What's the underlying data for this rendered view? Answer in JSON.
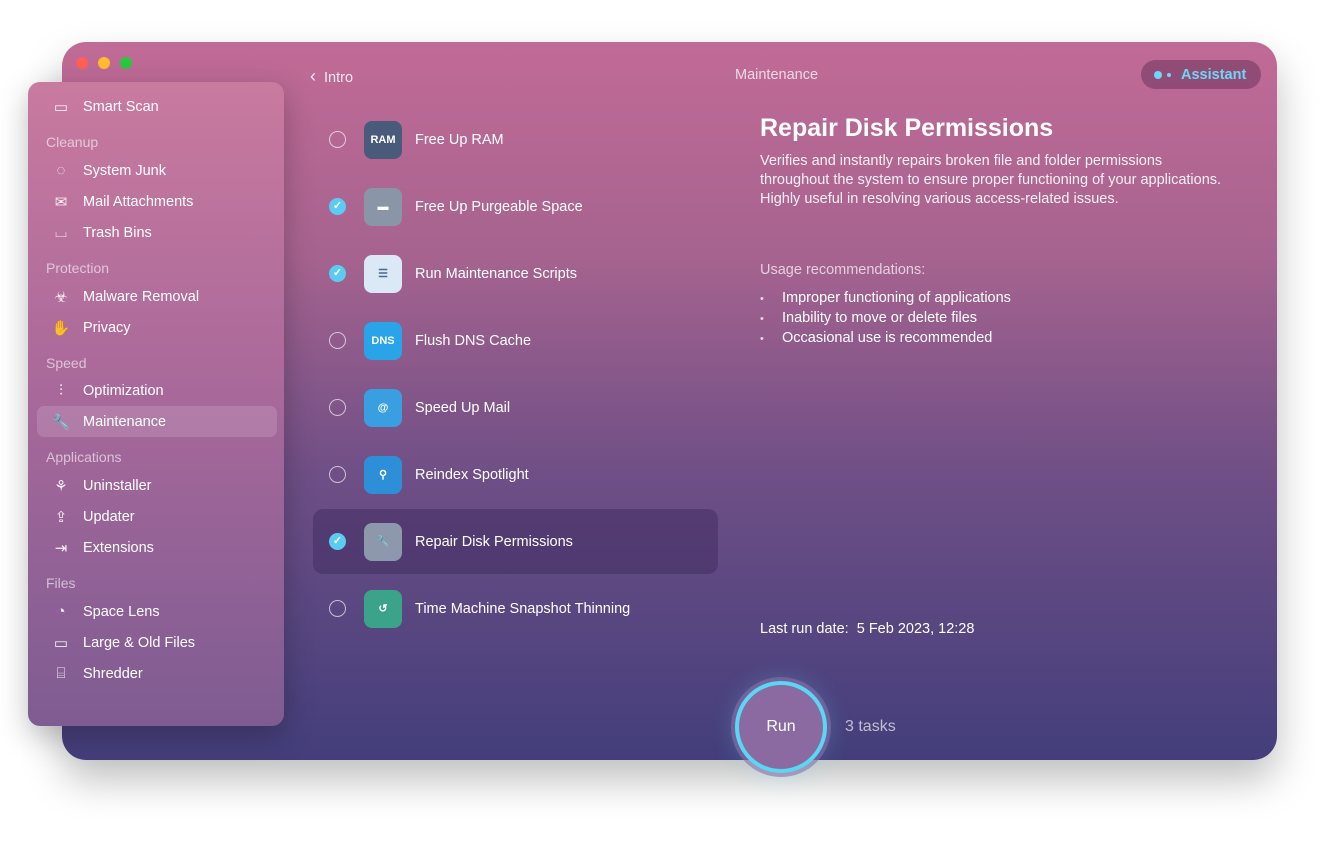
{
  "window": {
    "title": "Maintenance",
    "back_label": "Intro",
    "assistant_label": "Assistant"
  },
  "sidebar": {
    "smart_scan": "Smart Scan",
    "sections": [
      {
        "heading": "Cleanup",
        "items": [
          "System Junk",
          "Mail Attachments",
          "Trash Bins"
        ]
      },
      {
        "heading": "Protection",
        "items": [
          "Malware Removal",
          "Privacy"
        ]
      },
      {
        "heading": "Speed",
        "items": [
          "Optimization",
          "Maintenance"
        ]
      },
      {
        "heading": "Applications",
        "items": [
          "Uninstaller",
          "Updater",
          "Extensions"
        ]
      },
      {
        "heading": "Files",
        "items": [
          "Space Lens",
          "Large & Old Files",
          "Shredder"
        ]
      }
    ],
    "active": "Maintenance"
  },
  "tasks": [
    {
      "label": "Free Up RAM",
      "checked": false,
      "icon": "ram-icon",
      "icon_text": "RAM"
    },
    {
      "label": "Free Up Purgeable Space",
      "checked": true,
      "icon": "disk-icon"
    },
    {
      "label": "Run Maintenance Scripts",
      "checked": true,
      "icon": "clipboard-icon"
    },
    {
      "label": "Flush DNS Cache",
      "checked": false,
      "icon": "dns-icon",
      "icon_text": "DNS"
    },
    {
      "label": "Speed Up Mail",
      "checked": false,
      "icon": "mail-at-icon"
    },
    {
      "label": "Reindex Spotlight",
      "checked": false,
      "icon": "magnifier-icon"
    },
    {
      "label": "Repair Disk Permissions",
      "checked": true,
      "icon": "disk-wrench-icon",
      "selected": true
    },
    {
      "label": "Time Machine Snapshot Thinning",
      "checked": false,
      "icon": "time-machine-icon"
    }
  ],
  "detail": {
    "title": "Repair Disk Permissions",
    "description": "Verifies and instantly repairs broken file and folder permissions throughout the system to ensure proper functioning of your applications. Highly useful in resolving various access-related issues.",
    "usage_heading": "Usage recommendations:",
    "usage": [
      "Improper functioning of applications",
      "Inability to move or delete files",
      "Occasional use is recommended"
    ],
    "last_run_label": "Last run date:",
    "last_run_value": "5 Feb 2023, 12:28"
  },
  "footer": {
    "run_label": "Run",
    "task_count": "3 tasks"
  },
  "colors": {
    "accent": "#5ad7f3",
    "close": "#fe5f57",
    "minimize": "#febc2e",
    "zoom": "#28c840"
  }
}
